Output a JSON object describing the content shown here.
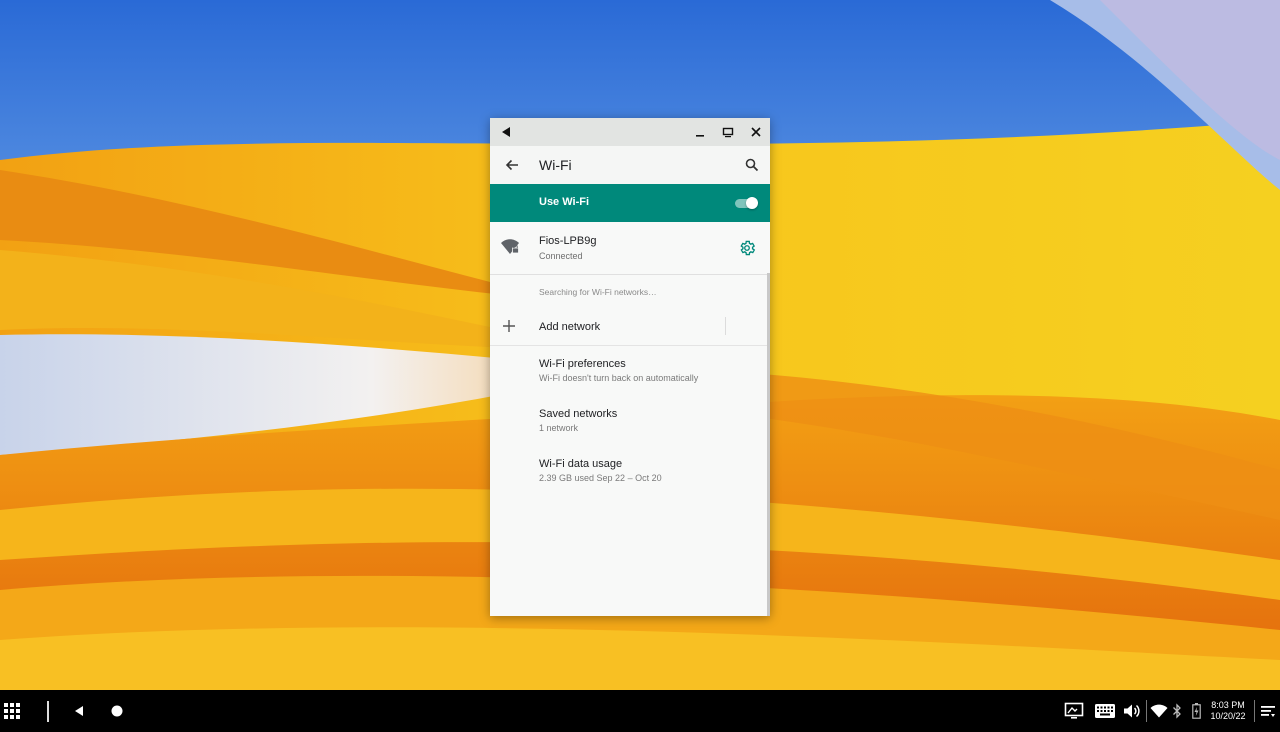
{
  "window": {
    "titlebar": {
      "back_label": "Back",
      "minimize_label": "Minimize",
      "maximize_label": "Maximize",
      "close_label": "Close"
    },
    "appbar": {
      "title": "Wi-Fi",
      "back_icon": "arrow-left-icon",
      "search_icon": "search-icon"
    },
    "master_switch": {
      "label": "Use Wi-Fi",
      "enabled": true,
      "accent": "#00897b"
    },
    "connected_network": {
      "name": "Fios-LPB9g",
      "status": "Connected",
      "icon": "wifi-lock-icon",
      "settings_icon": "gear-icon"
    },
    "searching_text": "Searching for Wi-Fi networks…",
    "add_network": {
      "label": "Add network",
      "icon": "plus-icon"
    },
    "preferences": [
      {
        "title": "Wi-Fi preferences",
        "subtitle": "Wi-Fi doesn't turn back on automatically"
      },
      {
        "title": "Saved networks",
        "subtitle": "1 network"
      },
      {
        "title": "Wi-Fi data usage",
        "subtitle": "2.39 GB used Sep 22 – Oct 20"
      }
    ]
  },
  "taskbar": {
    "left_icons": [
      "app-launcher-icon",
      "back-triangle-icon",
      "home-circle-icon"
    ],
    "tray_icons": [
      "screen-icon",
      "keyboard-icon",
      "volume-icon",
      "wifi-icon",
      "bluetooth-icon",
      "battery-icon",
      "notifications-icon"
    ],
    "clock": {
      "time": "8:03 PM",
      "date": "10/20/22"
    }
  }
}
